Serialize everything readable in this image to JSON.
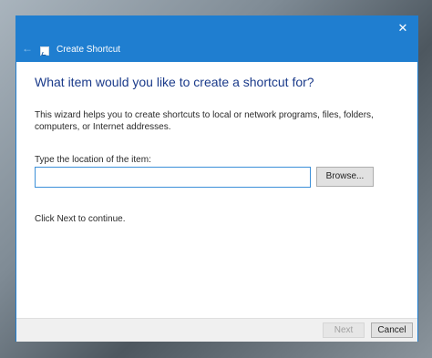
{
  "window": {
    "title": "Create Shortcut",
    "accent_color": "#1f7ed0",
    "back_icon": "back-arrow-icon",
    "app_icon": "shortcut-icon",
    "close_icon": "close-icon"
  },
  "wizard": {
    "heading": "What item would you like to create a shortcut for?",
    "description": "This wizard helps you to create shortcuts to local or network programs, files, folders, computers, or Internet addresses.",
    "input_label": "Type the location of the item:",
    "location_value": "",
    "browse_label": "Browse...",
    "continue_text": "Click Next to continue."
  },
  "footer": {
    "next_label": "Next",
    "next_enabled": false,
    "cancel_label": "Cancel"
  }
}
